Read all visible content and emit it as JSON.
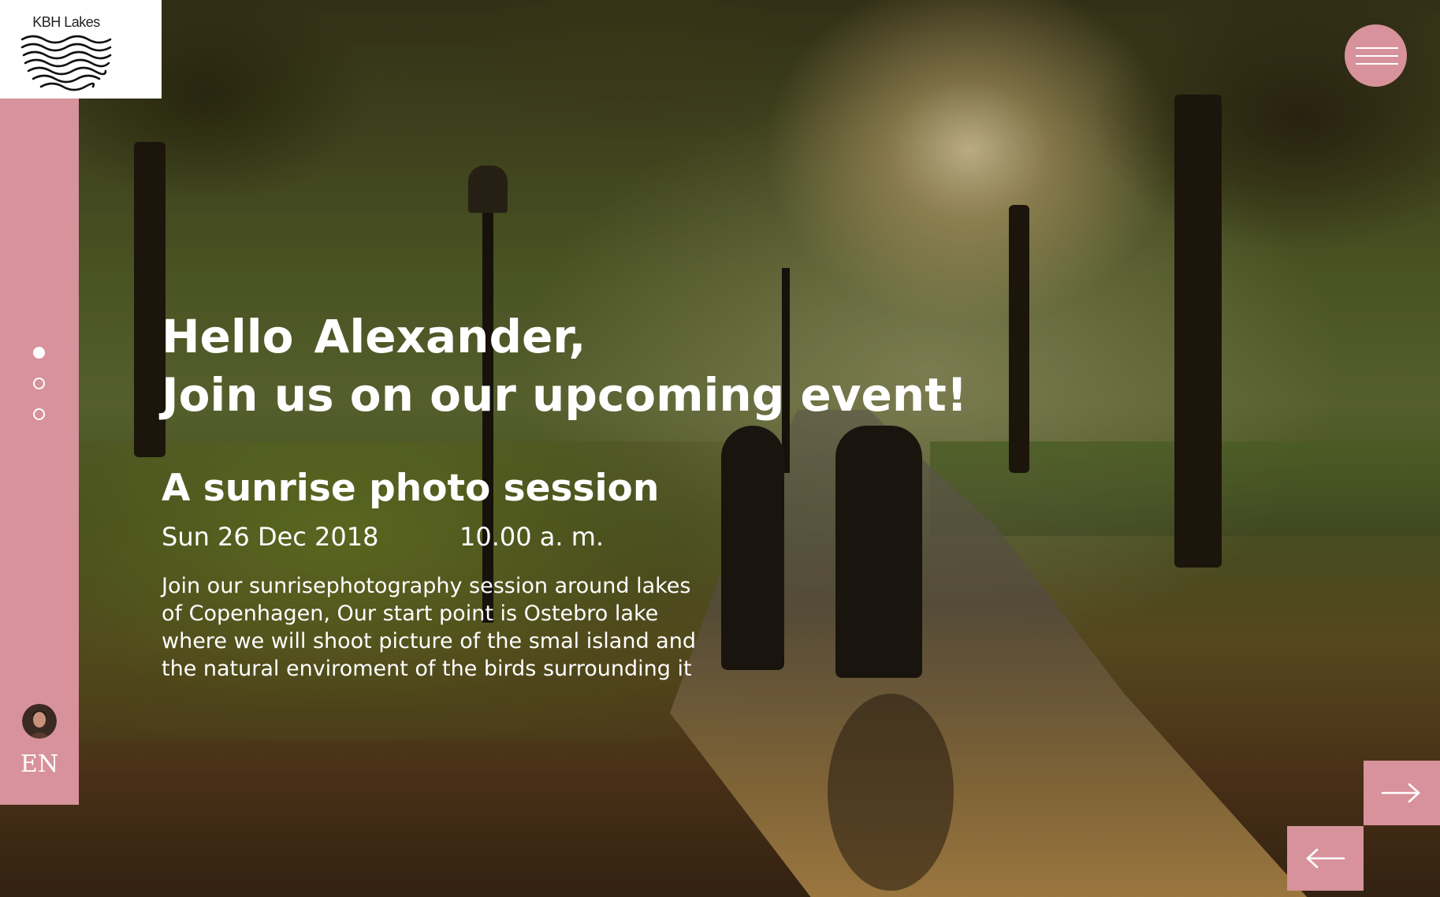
{
  "logo": {
    "brand": "KBH Lakes",
    "icon": "waves-icon"
  },
  "slider": {
    "total": 3,
    "active_index": 0
  },
  "user": {
    "avatar_icon": "user-avatar"
  },
  "language": {
    "current": "EN"
  },
  "menu": {
    "icon": "hamburger-icon"
  },
  "hero": {
    "greeting_hello": "Hello",
    "greeting_name": "Alexander,",
    "greeting_line2": "Join us on our upcoming event!"
  },
  "event": {
    "title": "A sunrise photo session",
    "date": "Sun 26 Dec 2018",
    "time": "10.00 a. m.",
    "description": "Join our sunrisephotography session around lakes of Copenhagen, Our start point is Ostebro lake where we will shoot picture of the smal island and the natural enviroment of the birds surrounding it"
  },
  "nav": {
    "next_icon": "arrow-right-icon",
    "prev_icon": "arrow-left-icon"
  },
  "colors": {
    "accent": "#d7929b",
    "text": "#ffffff"
  }
}
